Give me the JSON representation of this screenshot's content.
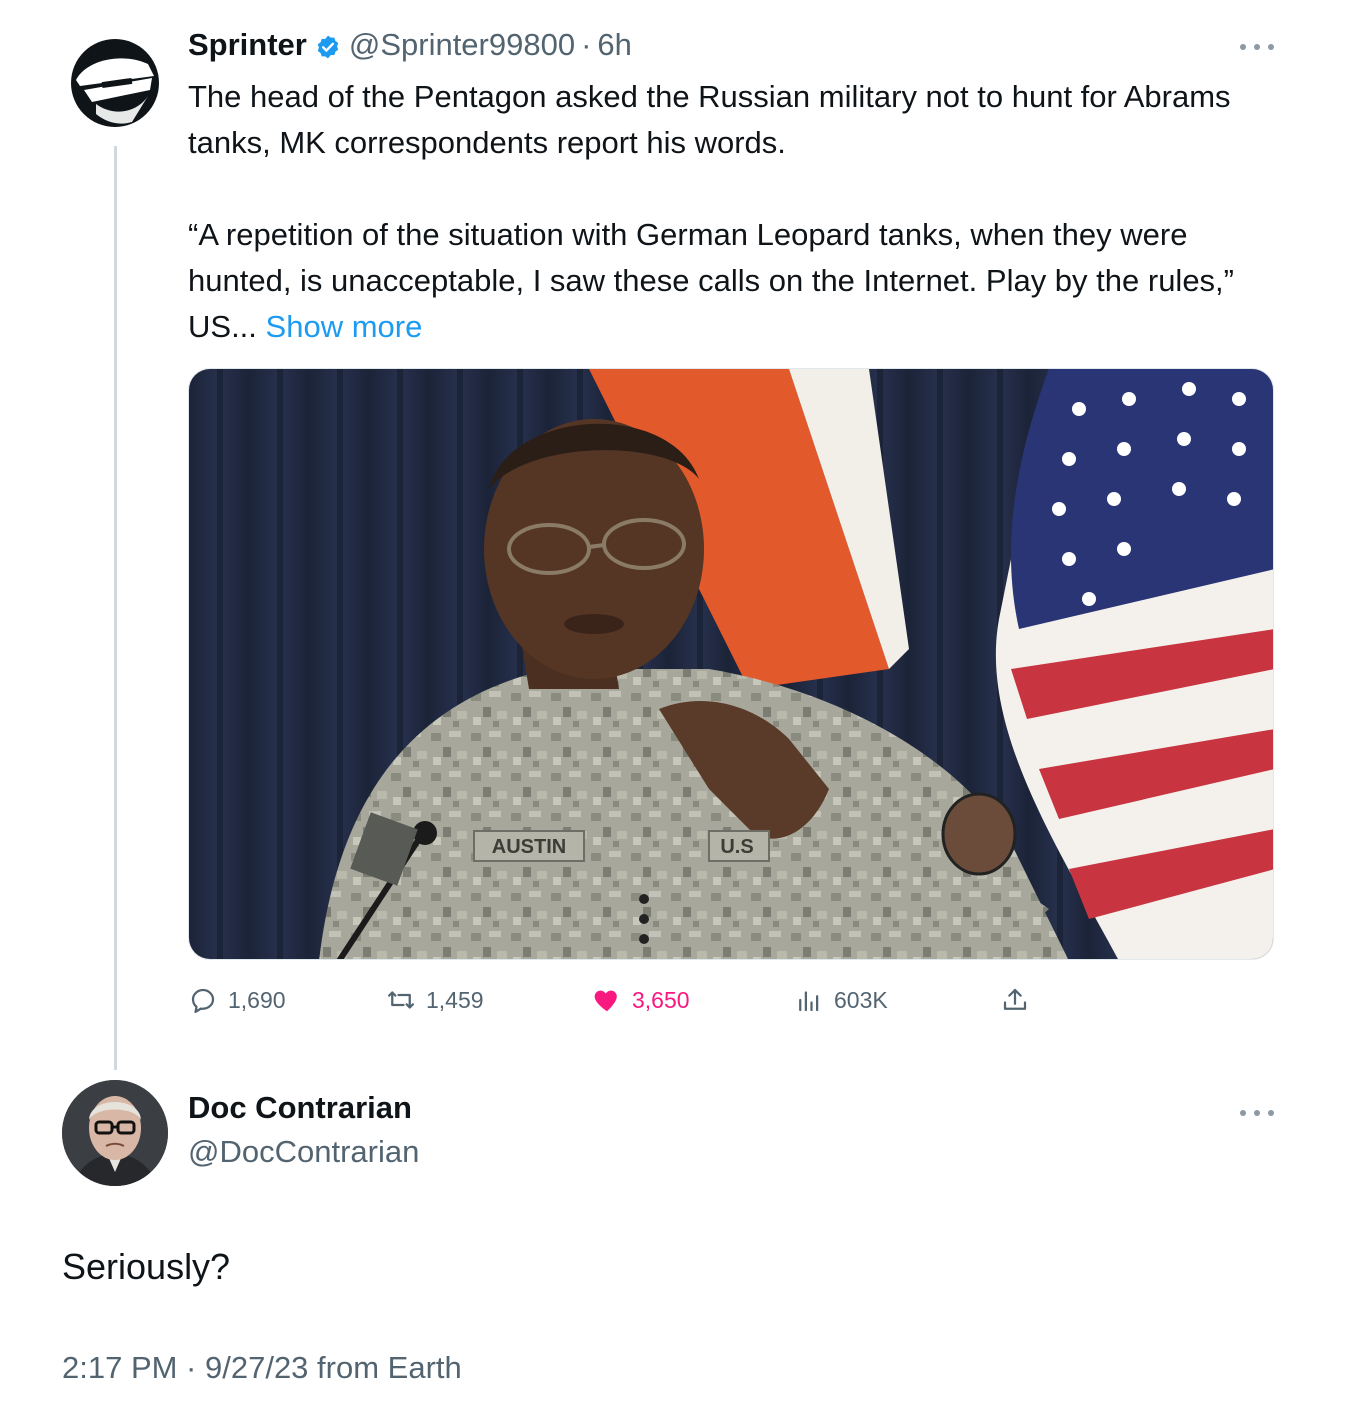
{
  "tweet": {
    "author_name": "Sprinter",
    "author_handle": "@Sprinter99800",
    "separator": "·",
    "time": "6h",
    "paragraph_1": "The head of the Pentagon asked the Russian military not to hunt for Abrams tanks, MK correspondents report his words.",
    "paragraph_2": "“A repetition of the situation with German Leopard tanks, when they were hunted, is unacceptable, I saw these calls on the Internet. Play by the rules,” US...",
    "show_more_label": "Show more",
    "media": {
      "uniform_tape": "AUSTIN",
      "uniform_tape_2": "U.S"
    },
    "stats": {
      "replies": "1,690",
      "retweets": "1,459",
      "likes": "3,650",
      "views": "603K"
    }
  },
  "reply": {
    "author_name": "Doc Contrarian",
    "author_handle": "@DocContrarian",
    "text": "Seriously?",
    "timestamp": "2:17 PM · 9/27/23 from Earth"
  },
  "colors": {
    "link": "#1d9bf0",
    "like": "#f91880",
    "secondary_text": "#536471",
    "verified": "#1d9bf0"
  }
}
